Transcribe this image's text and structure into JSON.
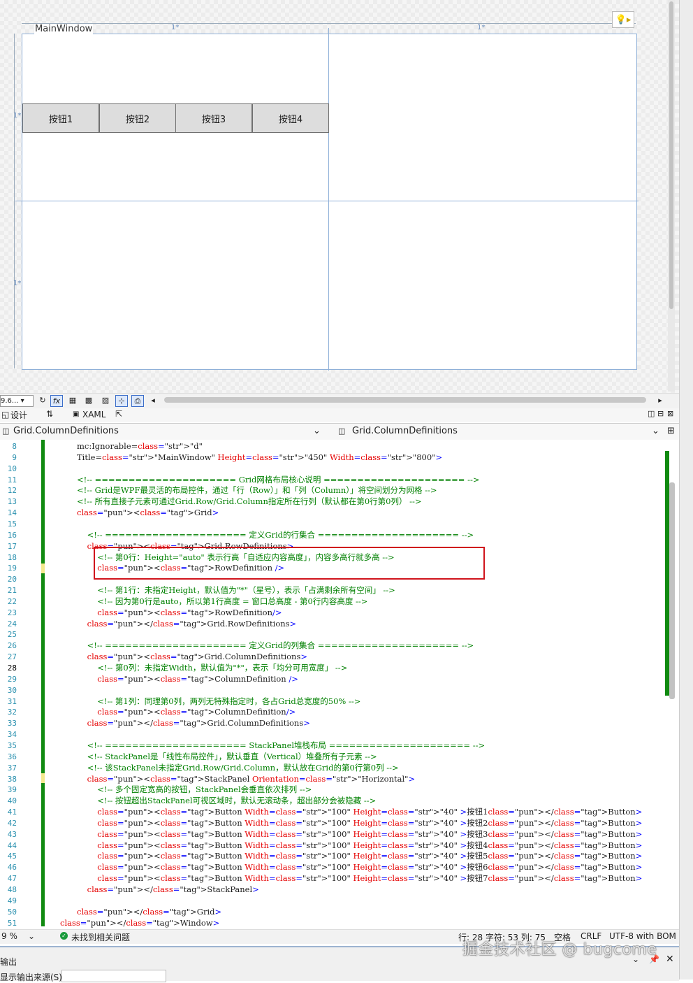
{
  "designer": {
    "window_title": "MainWindow",
    "col_star_1": "1*",
    "col_star_2": "1*",
    "row_star_1": "1*",
    "row_star_2": "1*",
    "buttons": [
      "按钮1",
      "按钮2",
      "按钮3",
      "按钮4"
    ]
  },
  "toolbar": {
    "zoom": "9.6...",
    "fx": "fx"
  },
  "tabs": {
    "design": "设计",
    "swap": "⇅",
    "xaml": "XAML"
  },
  "nav": {
    "left": "Grid.ColumnDefinitions",
    "right": "Grid.ColumnDefinitions"
  },
  "editor": {
    "current_line": 28,
    "line_numbers": [
      8,
      9,
      10,
      11,
      12,
      13,
      14,
      15,
      16,
      17,
      18,
      19,
      20,
      21,
      22,
      23,
      24,
      25,
      26,
      27,
      28,
      29,
      30,
      31,
      32,
      33,
      34,
      35,
      36,
      37,
      38,
      39,
      40,
      41,
      42,
      43,
      44,
      45,
      46,
      47,
      48,
      49,
      50,
      51
    ],
    "lines": [
      "mc:Ignorable=\"d\"",
      "Title=\"MainWindow\" Height=\"450\" Width=\"800\">",
      "",
      "<!-- ===================== Grid网格布局核心说明 ===================== -->",
      "<!-- Grid是WPF最灵活的布局控件，通过「行（Row）」和「列（Column）」将空间划分为网格 -->",
      "<!-- 所有直接子元素可通过Grid.Row/Grid.Column指定所在行列（默认都在第0行第0列） -->",
      "<Grid>",
      "",
      "    <!-- ===================== 定义Grid的行集合 ===================== -->",
      "    <Grid.RowDefinitions>",
      "        <!-- 第0行：Height=\"auto\" 表示行高「自适应内容高度」，内容多高行就多高 -->",
      "        <RowDefinition />",
      "",
      "        <!-- 第1行：未指定Height，默认值为\"*\"（星号），表示「占满剩余所有空间」 -->",
      "        <!-- 因为第0行是auto，所以第1行高度 = 窗口总高度 - 第0行内容高度 -->",
      "        <RowDefinition/>",
      "    </Grid.RowDefinitions>",
      "",
      "    <!-- ===================== 定义Grid的列集合 ===================== -->",
      "    <Grid.ColumnDefinitions>",
      "        <!-- 第0列：未指定Width，默认值为\"*\"，表示「均分可用宽度」 -->",
      "        <ColumnDefinition />",
      "",
      "        <!-- 第1列：同理第0列，两列无特殊指定时，各占Grid总宽度的50% -->",
      "        <ColumnDefinition/>",
      "    </Grid.ColumnDefinitions>",
      "",
      "    <!-- ===================== StackPanel堆栈布局 ===================== -->",
      "    <!-- StackPanel是「线性布局控件」，默认垂直（Vertical）堆叠所有子元素 -->",
      "    <!-- 该StackPanel未指定Grid.Row/Grid.Column，默认放在Grid的第0行第0列 -->",
      "    <StackPanel Orientation=\"Horizontal\">",
      "        <!-- 多个固定宽高的按钮，StackPanel会垂直依次排列 -->",
      "        <!-- 按钮超出StackPanel可视区域时，默认无滚动条，超出部分会被隐藏 -->",
      "        <Button Width=\"100\" Height=\"40\" >按钮1</Button>",
      "        <Button Width=\"100\" Height=\"40\" >按钮2</Button>",
      "        <Button Width=\"100\" Height=\"40\" >按钮3</Button>",
      "        <Button Width=\"100\" Height=\"40\" >按钮4</Button>",
      "        <Button Width=\"100\" Height=\"40\" >按钮5</Button>",
      "        <Button Width=\"100\" Height=\"40\" >按钮6</Button>",
      "        <Button Width=\"100\" Height=\"40\" >按钮7</Button>",
      "    </StackPanel>",
      "",
      "</Grid>",
      "</Window>"
    ]
  },
  "status": {
    "zoom": "9 %",
    "issues": "未找到相关问题",
    "position": "行: 28  字符: 53  列: 75",
    "whitespace": "空格",
    "line_ending": "CRLF",
    "encoding": "UTF-8 with BOM"
  },
  "output": {
    "title": "输出",
    "source_label": "显示输出来源(S):"
  },
  "watermark": "掘金技术社区 @ bugcome"
}
